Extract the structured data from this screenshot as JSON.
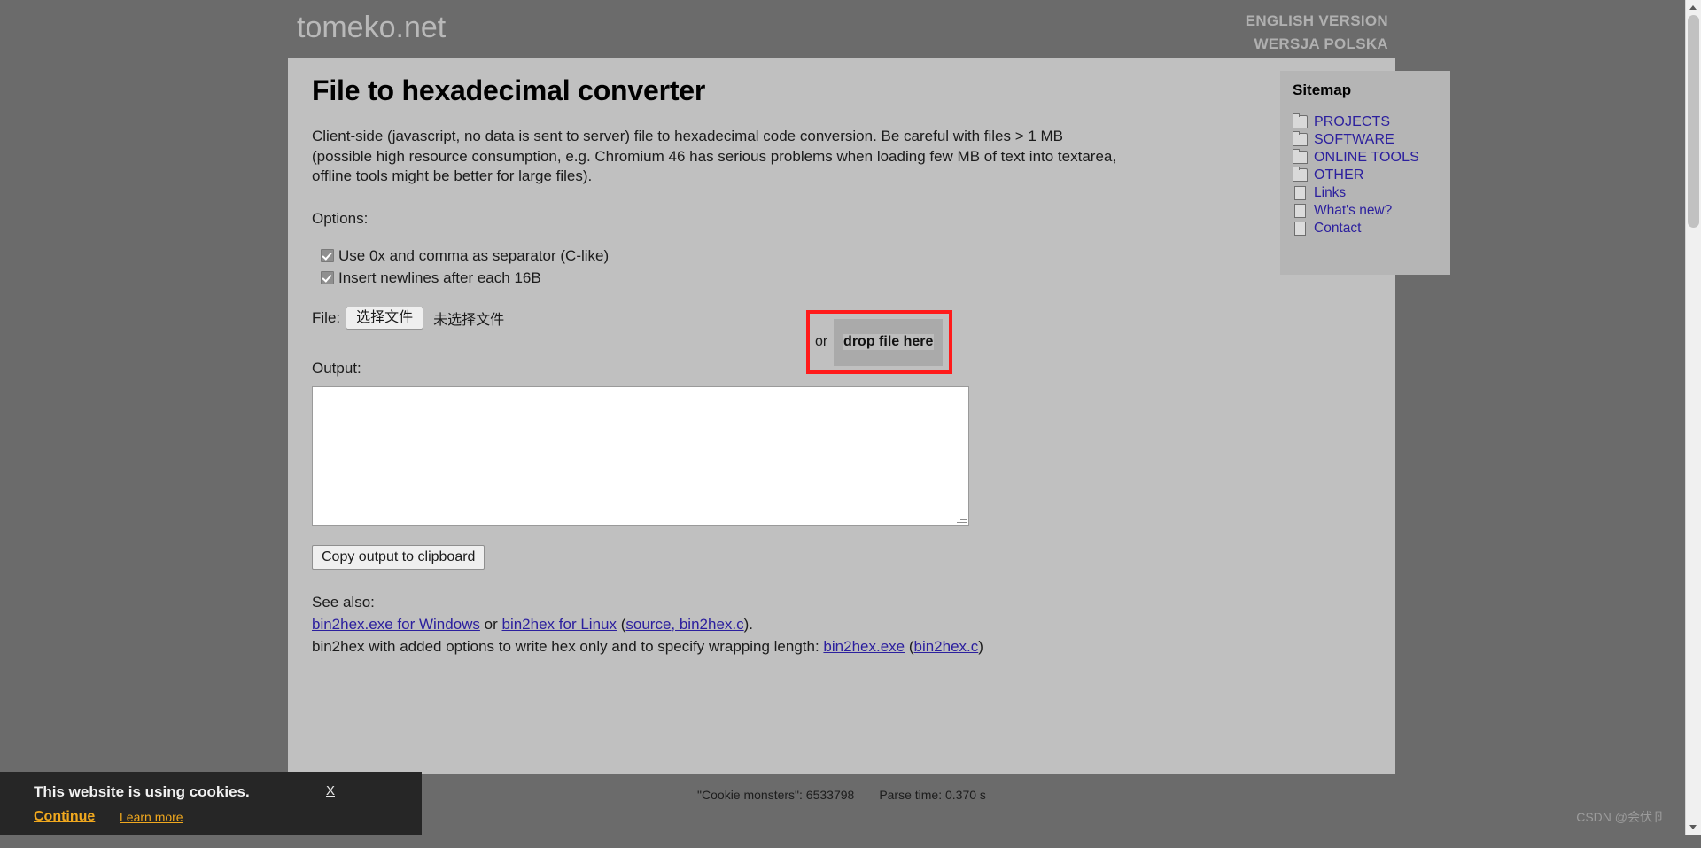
{
  "header": {
    "logo": "tomeko.net",
    "lang_links": [
      {
        "label": "ENGLISH VERSION"
      },
      {
        "label": "WERSJA POLSKA"
      }
    ]
  },
  "main": {
    "title": "File to hexadecimal converter",
    "intro": "Client-side (javascript, no data is sent to server) file to hexadecimal code conversion. Be careful with files > 1 MB (possible high resource consumption, e.g. Chromium 46 has serious problems when loading few MB of text into textarea, offline tools might be better for large files).",
    "options_label": "Options:",
    "options": [
      {
        "label": "Use 0x and comma as separator (C-like)",
        "checked": true
      },
      {
        "label": "Insert newlines after each 16B",
        "checked": true
      }
    ],
    "file": {
      "label": "File:",
      "button_label": "选择文件",
      "status": "未选择文件"
    },
    "drop": {
      "or_label": "or",
      "drop_label": "drop file here",
      "highlight_color": "#ff1a1a"
    },
    "output_label": "Output:",
    "output_value": "",
    "copy_button": "Copy output to clipboard",
    "see_also": {
      "heading": "See also:",
      "line1_link1": "bin2hex.exe for Windows",
      "line1_mid": " or ",
      "line1_link2": "bin2hex for Linux",
      "line1_open": " (",
      "line1_link3": "source, bin2hex.c",
      "line1_close": ").",
      "line2_pre": "bin2hex with added options to write hex only and to specify wrapping length: ",
      "line2_link1": "bin2hex.exe",
      "line2_mid": " (",
      "line2_link2": "bin2hex.c",
      "line2_close": ")"
    }
  },
  "sidebar": {
    "title": "Sitemap",
    "items": [
      {
        "label": "PROJECTS",
        "icon": "folder-icon"
      },
      {
        "label": "SOFTWARE",
        "icon": "folder-icon"
      },
      {
        "label": "ONLINE TOOLS",
        "icon": "folder-icon"
      },
      {
        "label": "OTHER",
        "icon": "folder-icon"
      },
      {
        "label": "Links",
        "icon": "page-icon"
      },
      {
        "label": "What's new?",
        "icon": "page-icon"
      },
      {
        "label": "Contact",
        "icon": "page-icon"
      }
    ]
  },
  "footer": {
    "cookie_monsters": "\"Cookie monsters\": 6533798",
    "parse_time": "Parse time: 0.370 s"
  },
  "cookie_banner": {
    "title": "This website is using cookies.",
    "close": "X",
    "continue": "Continue",
    "learn_more": "Learn more",
    "accent_color": "#f0a81e"
  },
  "watermark": "CSDN @会伏卪"
}
